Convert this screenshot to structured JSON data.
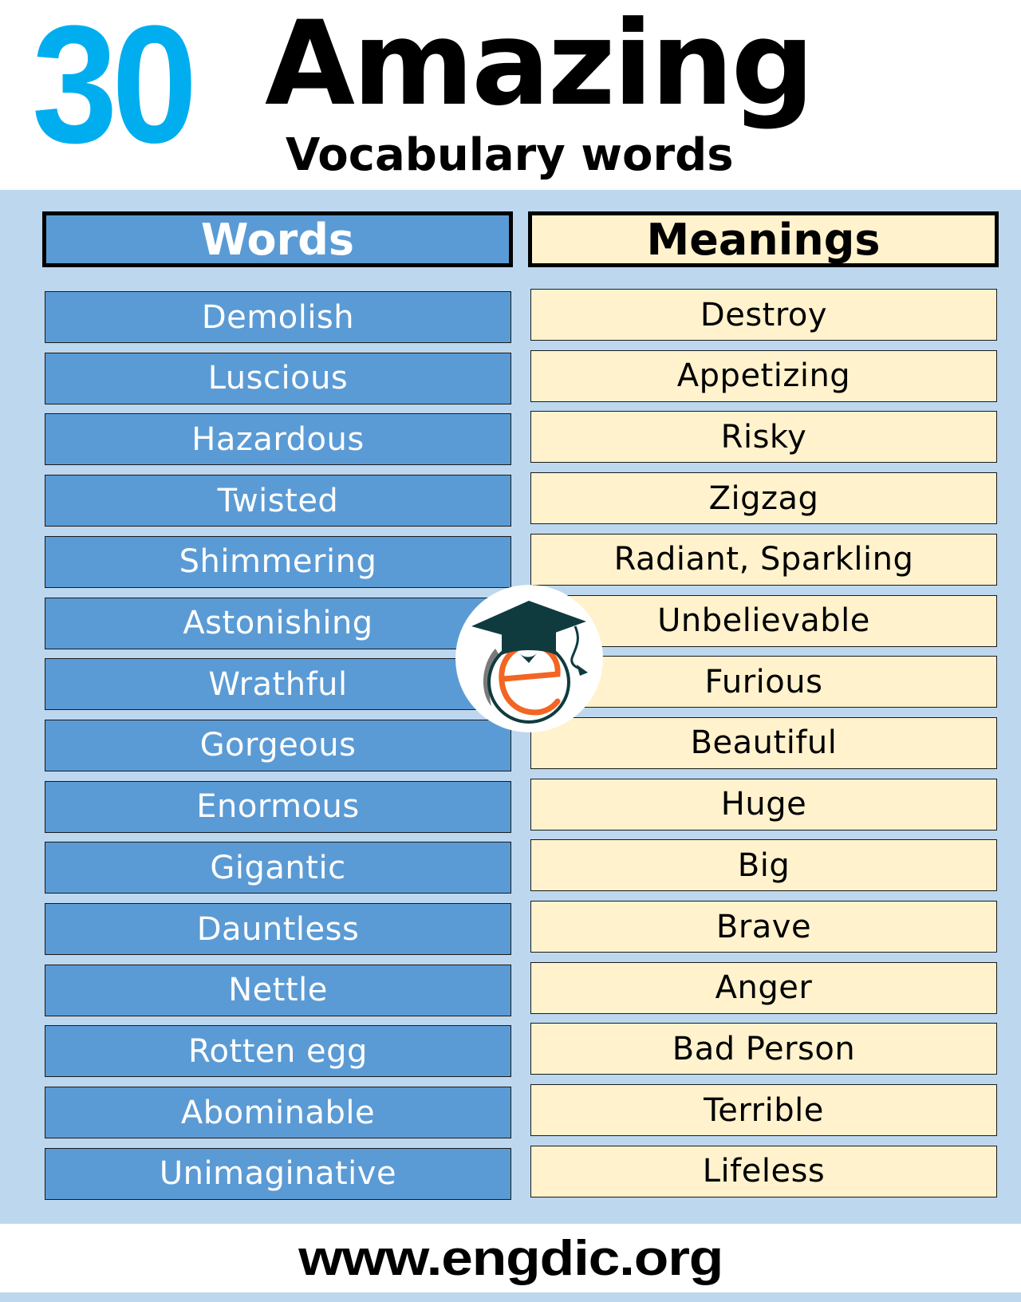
{
  "header": {
    "number": "30",
    "title": "Amazing",
    "subtitle": "Vocabulary words"
  },
  "columns": {
    "words_label": "Words",
    "meanings_label": "Meanings"
  },
  "rows": [
    {
      "word": "Demolish",
      "meaning": "Destroy"
    },
    {
      "word": "Luscious",
      "meaning": "Appetizing"
    },
    {
      "word": "Hazardous",
      "meaning": "Risky"
    },
    {
      "word": "Twisted",
      "meaning": "Zigzag"
    },
    {
      "word": "Shimmering",
      "meaning": "Radiant, Sparkling"
    },
    {
      "word": "Astonishing",
      "meaning": "Unbelievable"
    },
    {
      "word": "Wrathful",
      "meaning": "Furious"
    },
    {
      "word": "Gorgeous",
      "meaning": "Beautiful"
    },
    {
      "word": "Enormous",
      "meaning": "Huge"
    },
    {
      "word": "Gigantic",
      "meaning": "Big"
    },
    {
      "word": "Dauntless",
      "meaning": "Brave"
    },
    {
      "word": "Nettle",
      "meaning": "Anger"
    },
    {
      "word": "Rotten egg",
      "meaning": "Bad Person"
    },
    {
      "word": "Abominable",
      "meaning": "Terrible"
    },
    {
      "word": "Unimaginative",
      "meaning": "Lifeless"
    }
  ],
  "logo": {
    "icon": "graduation-cap-e-logo-icon",
    "letter": "e"
  },
  "footer": {
    "url": "www.engdic.org"
  },
  "colors": {
    "accent_number": "#00aeef",
    "panel_background": "#bdd7ee",
    "word_cell": "#5b9bd5",
    "meaning_cell": "#fff2cc",
    "logo_orange": "#f26522",
    "logo_dark": "#0f3b3f"
  }
}
